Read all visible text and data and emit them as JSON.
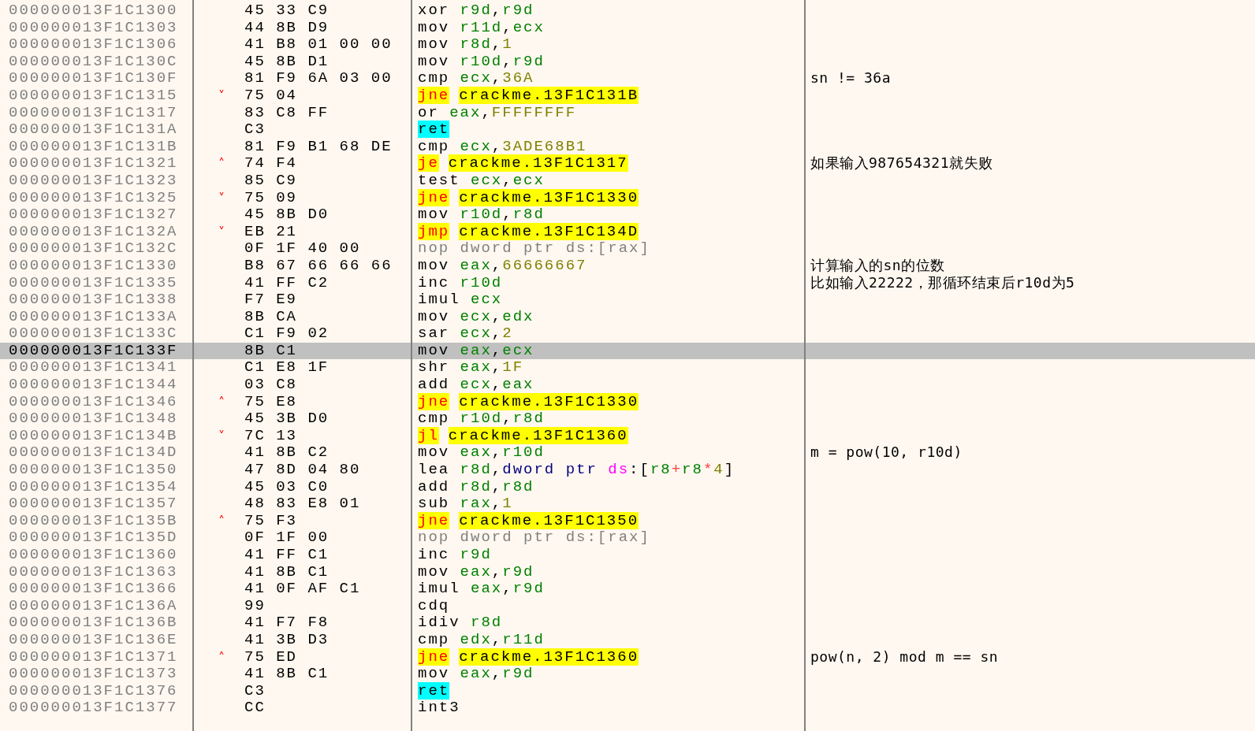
{
  "rows": [
    {
      "address": "000000013F1C1300",
      "selected": false,
      "bytes": "45 33 C9",
      "instruction": [
        {
          "kind": "mnem",
          "text": "xor "
        },
        {
          "kind": "reg",
          "text": "r9d"
        },
        {
          "kind": "punct",
          "text": ","
        },
        {
          "kind": "reg",
          "text": "r9d"
        }
      ]
    },
    {
      "address": "000000013F1C1303",
      "selected": false,
      "bytes": "44 8B D9",
      "instruction": [
        {
          "kind": "mnem",
          "text": "mov "
        },
        {
          "kind": "reg",
          "text": "r11d"
        },
        {
          "kind": "punct",
          "text": ","
        },
        {
          "kind": "reg",
          "text": "ecx"
        }
      ]
    },
    {
      "address": "000000013F1C1306",
      "selected": false,
      "bytes": "41 B8 01 00 00",
      "instruction": [
        {
          "kind": "mnem",
          "text": "mov "
        },
        {
          "kind": "reg",
          "text": "r8d"
        },
        {
          "kind": "punct",
          "text": ","
        },
        {
          "kind": "num",
          "text": "1"
        }
      ]
    },
    {
      "address": "000000013F1C130C",
      "selected": false,
      "bytes": "45 8B D1",
      "instruction": [
        {
          "kind": "mnem",
          "text": "mov "
        },
        {
          "kind": "reg",
          "text": "r10d"
        },
        {
          "kind": "punct",
          "text": ","
        },
        {
          "kind": "reg",
          "text": "r9d"
        }
      ]
    },
    {
      "address": "000000013F1C130F",
      "selected": false,
      "bytes": "81 F9 6A 03 00",
      "instruction": [
        {
          "kind": "mnem",
          "text": "cmp "
        },
        {
          "kind": "reg",
          "text": "ecx"
        },
        {
          "kind": "punct",
          "text": ","
        },
        {
          "kind": "num",
          "text": "36A"
        }
      ],
      "comment": "sn != 36a"
    },
    {
      "address": "000000013F1C1315",
      "selected": false,
      "arrow": "˅",
      "bytes": "75 04",
      "instruction": [
        {
          "kind": "jmp",
          "text": "jne"
        },
        {
          "kind": "target",
          "text": "crackme.13F1C131B"
        }
      ]
    },
    {
      "address": "000000013F1C1317",
      "selected": false,
      "bytes": "83 C8 FF",
      "instruction": [
        {
          "kind": "mnem",
          "text": "or "
        },
        {
          "kind": "reg",
          "text": "eax"
        },
        {
          "kind": "punct",
          "text": ","
        },
        {
          "kind": "num",
          "text": "FFFFFFFF"
        }
      ]
    },
    {
      "address": "000000013F1C131A",
      "selected": false,
      "bytes": "C3",
      "instruction": [
        {
          "kind": "ret",
          "text": "ret"
        }
      ]
    },
    {
      "address": "000000013F1C131B",
      "selected": false,
      "bytes": "81 F9 B1 68 DE",
      "instruction": [
        {
          "kind": "mnem",
          "text": "cmp "
        },
        {
          "kind": "reg",
          "text": "ecx"
        },
        {
          "kind": "punct",
          "text": ","
        },
        {
          "kind": "num",
          "text": "3ADE68B1"
        }
      ]
    },
    {
      "address": "000000013F1C1321",
      "selected": false,
      "arrow": "˄",
      "bytes": "74 F4",
      "instruction": [
        {
          "kind": "jmp",
          "text": "je"
        },
        {
          "kind": "target",
          "text": "crackme.13F1C1317"
        }
      ],
      "comment": "如果输入987654321就失败"
    },
    {
      "address": "000000013F1C1323",
      "selected": false,
      "bytes": "85 C9",
      "instruction": [
        {
          "kind": "mnem",
          "text": "test "
        },
        {
          "kind": "reg",
          "text": "ecx"
        },
        {
          "kind": "punct",
          "text": ","
        },
        {
          "kind": "reg",
          "text": "ecx"
        }
      ]
    },
    {
      "address": "000000013F1C1325",
      "selected": false,
      "arrow": "˅",
      "bytes": "75 09",
      "instruction": [
        {
          "kind": "jmp",
          "text": "jne"
        },
        {
          "kind": "target",
          "text": "crackme.13F1C1330"
        }
      ]
    },
    {
      "address": "000000013F1C1327",
      "selected": false,
      "bytes": "45 8B D0",
      "instruction": [
        {
          "kind": "mnem",
          "text": "mov "
        },
        {
          "kind": "reg",
          "text": "r10d"
        },
        {
          "kind": "punct",
          "text": ","
        },
        {
          "kind": "reg",
          "text": "r8d"
        }
      ]
    },
    {
      "address": "000000013F1C132A",
      "selected": false,
      "arrow": "˅",
      "bytes": "EB 21",
      "instruction": [
        {
          "kind": "jmp",
          "text": "jmp"
        },
        {
          "kind": "target",
          "text": "crackme.13F1C134D"
        }
      ]
    },
    {
      "address": "000000013F1C132C",
      "selected": false,
      "bytes": "0F 1F 40 00",
      "instruction": [
        {
          "kind": "nop",
          "text": "nop dword ptr ds:[rax]"
        }
      ]
    },
    {
      "address": "000000013F1C1330",
      "selected": false,
      "bytes": "B8 67 66 66 66",
      "instruction": [
        {
          "kind": "mnem",
          "text": "mov "
        },
        {
          "kind": "reg",
          "text": "eax"
        },
        {
          "kind": "punct",
          "text": ","
        },
        {
          "kind": "num",
          "text": "66666667"
        }
      ],
      "comment": "计算输入的sn的位数"
    },
    {
      "address": "000000013F1C1335",
      "selected": false,
      "bytes": "41 FF C2",
      "instruction": [
        {
          "kind": "mnem",
          "text": "inc "
        },
        {
          "kind": "reg",
          "text": "r10d"
        }
      ],
      "comment": "比如输入22222，那循环结束后r10d为5"
    },
    {
      "address": "000000013F1C1338",
      "selected": false,
      "bytes": "F7 E9",
      "instruction": [
        {
          "kind": "mnem",
          "text": "imul "
        },
        {
          "kind": "reg",
          "text": "ecx"
        }
      ]
    },
    {
      "address": "000000013F1C133A",
      "selected": false,
      "bytes": "8B CA",
      "instruction": [
        {
          "kind": "mnem",
          "text": "mov "
        },
        {
          "kind": "reg",
          "text": "ecx"
        },
        {
          "kind": "punct",
          "text": ","
        },
        {
          "kind": "reg",
          "text": "edx"
        }
      ]
    },
    {
      "address": "000000013F1C133C",
      "selected": false,
      "bytes": "C1 F9 02",
      "instruction": [
        {
          "kind": "mnem",
          "text": "sar "
        },
        {
          "kind": "reg",
          "text": "ecx"
        },
        {
          "kind": "punct",
          "text": ","
        },
        {
          "kind": "num",
          "text": "2"
        }
      ]
    },
    {
      "address": "000000013F1C133F",
      "selected": true,
      "bytes": "8B C1",
      "instruction": [
        {
          "kind": "mnem",
          "text": "mov "
        },
        {
          "kind": "reg",
          "text": "eax"
        },
        {
          "kind": "punct",
          "text": ","
        },
        {
          "kind": "reg",
          "text": "ecx"
        }
      ]
    },
    {
      "address": "000000013F1C1341",
      "selected": false,
      "bytes": "C1 E8 1F",
      "instruction": [
        {
          "kind": "mnem",
          "text": "shr "
        },
        {
          "kind": "reg",
          "text": "eax"
        },
        {
          "kind": "punct",
          "text": ","
        },
        {
          "kind": "num",
          "text": "1F"
        }
      ]
    },
    {
      "address": "000000013F1C1344",
      "selected": false,
      "bytes": "03 C8",
      "instruction": [
        {
          "kind": "mnem",
          "text": "add "
        },
        {
          "kind": "reg",
          "text": "ecx"
        },
        {
          "kind": "punct",
          "text": ","
        },
        {
          "kind": "reg",
          "text": "eax"
        }
      ]
    },
    {
      "address": "000000013F1C1346",
      "selected": false,
      "arrow": "˄",
      "bytes": "75 E8",
      "instruction": [
        {
          "kind": "jmp",
          "text": "jne"
        },
        {
          "kind": "target",
          "text": "crackme.13F1C1330"
        }
      ]
    },
    {
      "address": "000000013F1C1348",
      "selected": false,
      "bytes": "45 3B D0",
      "instruction": [
        {
          "kind": "mnem",
          "text": "cmp "
        },
        {
          "kind": "reg",
          "text": "r10d"
        },
        {
          "kind": "punct",
          "text": ","
        },
        {
          "kind": "reg",
          "text": "r8d"
        }
      ]
    },
    {
      "address": "000000013F1C134B",
      "selected": false,
      "arrow": "˅",
      "bytes": "7C 13",
      "instruction": [
        {
          "kind": "jmp",
          "text": "jl"
        },
        {
          "kind": "target",
          "text": "crackme.13F1C1360"
        }
      ]
    },
    {
      "address": "000000013F1C134D",
      "selected": false,
      "bytes": "41 8B C2",
      "instruction": [
        {
          "kind": "mnem",
          "text": "mov "
        },
        {
          "kind": "reg",
          "text": "eax"
        },
        {
          "kind": "punct",
          "text": ","
        },
        {
          "kind": "reg",
          "text": "r10d"
        }
      ],
      "comment": "m = pow(10, r10d)"
    },
    {
      "address": "000000013F1C1350",
      "selected": false,
      "bytes": "47 8D 04 80",
      "instruction": [
        {
          "kind": "mnem",
          "text": "lea "
        },
        {
          "kind": "reg",
          "text": "r8d"
        },
        {
          "kind": "punct",
          "text": ","
        },
        {
          "kind": "size",
          "text": "dword ptr "
        },
        {
          "kind": "seg",
          "text": "ds"
        },
        {
          "kind": "punct",
          "text": ":["
        },
        {
          "kind": "reg",
          "text": "r8"
        },
        {
          "kind": "op",
          "text": "+"
        },
        {
          "kind": "reg",
          "text": "r8"
        },
        {
          "kind": "op",
          "text": "*"
        },
        {
          "kind": "num",
          "text": "4"
        },
        {
          "kind": "punct",
          "text": "]"
        }
      ]
    },
    {
      "address": "000000013F1C1354",
      "selected": false,
      "bytes": "45 03 C0",
      "instruction": [
        {
          "kind": "mnem",
          "text": "add "
        },
        {
          "kind": "reg",
          "text": "r8d"
        },
        {
          "kind": "punct",
          "text": ","
        },
        {
          "kind": "reg",
          "text": "r8d"
        }
      ]
    },
    {
      "address": "000000013F1C1357",
      "selected": false,
      "bytes": "48 83 E8 01",
      "instruction": [
        {
          "kind": "mnem",
          "text": "sub "
        },
        {
          "kind": "reg",
          "text": "rax"
        },
        {
          "kind": "punct",
          "text": ","
        },
        {
          "kind": "num",
          "text": "1"
        }
      ]
    },
    {
      "address": "000000013F1C135B",
      "selected": false,
      "arrow": "˄",
      "bytes": "75 F3",
      "instruction": [
        {
          "kind": "jmp",
          "text": "jne"
        },
        {
          "kind": "target",
          "text": "crackme.13F1C1350"
        }
      ]
    },
    {
      "address": "000000013F1C135D",
      "selected": false,
      "bytes": "0F 1F 00",
      "instruction": [
        {
          "kind": "nop",
          "text": "nop dword ptr ds:[rax]"
        }
      ]
    },
    {
      "address": "000000013F1C1360",
      "selected": false,
      "bytes": "41 FF C1",
      "instruction": [
        {
          "kind": "mnem",
          "text": "inc "
        },
        {
          "kind": "reg",
          "text": "r9d"
        }
      ]
    },
    {
      "address": "000000013F1C1363",
      "selected": false,
      "bytes": "41 8B C1",
      "instruction": [
        {
          "kind": "mnem",
          "text": "mov "
        },
        {
          "kind": "reg",
          "text": "eax"
        },
        {
          "kind": "punct",
          "text": ","
        },
        {
          "kind": "reg",
          "text": "r9d"
        }
      ]
    },
    {
      "address": "000000013F1C1366",
      "selected": false,
      "bytes": "41 0F AF C1",
      "instruction": [
        {
          "kind": "mnem",
          "text": "imul "
        },
        {
          "kind": "reg",
          "text": "eax"
        },
        {
          "kind": "punct",
          "text": ","
        },
        {
          "kind": "reg",
          "text": "r9d"
        }
      ]
    },
    {
      "address": "000000013F1C136A",
      "selected": false,
      "bytes": "99",
      "instruction": [
        {
          "kind": "mnem",
          "text": "cdq"
        }
      ]
    },
    {
      "address": "000000013F1C136B",
      "selected": false,
      "bytes": "41 F7 F8",
      "instruction": [
        {
          "kind": "mnem",
          "text": "idiv "
        },
        {
          "kind": "reg",
          "text": "r8d"
        }
      ]
    },
    {
      "address": "000000013F1C136E",
      "selected": false,
      "bytes": "41 3B D3",
      "instruction": [
        {
          "kind": "mnem",
          "text": "cmp "
        },
        {
          "kind": "reg",
          "text": "edx"
        },
        {
          "kind": "punct",
          "text": ","
        },
        {
          "kind": "reg",
          "text": "r11d"
        }
      ]
    },
    {
      "address": "000000013F1C1371",
      "selected": false,
      "arrow": "˄",
      "bytes": "75 ED",
      "instruction": [
        {
          "kind": "jmp",
          "text": "jne"
        },
        {
          "kind": "target",
          "text": "crackme.13F1C1360"
        }
      ],
      "comment": "pow(n, 2) mod m == sn"
    },
    {
      "address": "000000013F1C1373",
      "selected": false,
      "bytes": "41 8B C1",
      "instruction": [
        {
          "kind": "mnem",
          "text": "mov "
        },
        {
          "kind": "reg",
          "text": "eax"
        },
        {
          "kind": "punct",
          "text": ","
        },
        {
          "kind": "reg",
          "text": "r9d"
        }
      ]
    },
    {
      "address": "000000013F1C1376",
      "selected": false,
      "bytes": "C3",
      "instruction": [
        {
          "kind": "ret",
          "text": "ret"
        }
      ]
    },
    {
      "address": "000000013F1C1377",
      "selected": false,
      "bytes": "CC",
      "instruction": [
        {
          "kind": "mnem",
          "text": "int3"
        }
      ]
    }
  ]
}
